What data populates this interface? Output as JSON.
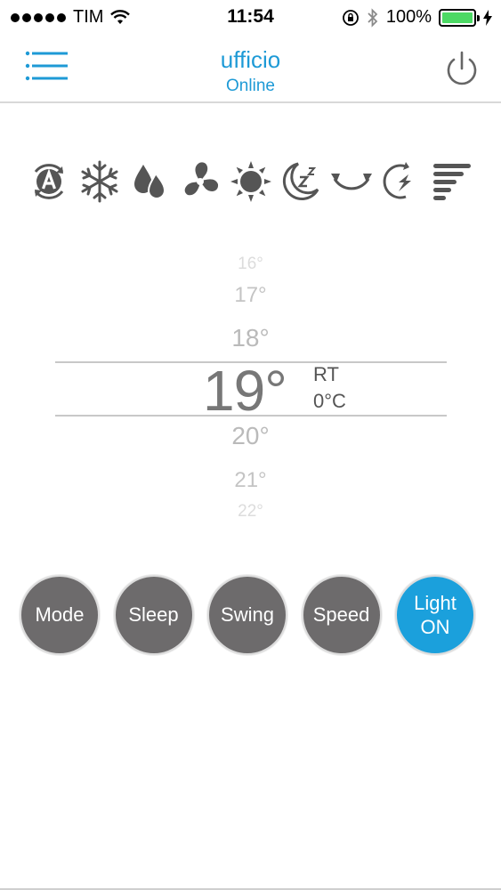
{
  "status_bar": {
    "carrier": "TIM",
    "time": "11:54",
    "battery_percent": "100%",
    "signal_dots": 5,
    "battery_level": 1.0,
    "battery_color": "#4cd964"
  },
  "header": {
    "title": "ufficio",
    "subtitle": "Online",
    "accent_color": "#1e9ad6",
    "menu_icon": "hamburger-menu-icon",
    "power_icon": "power-icon"
  },
  "mode_icons": [
    {
      "name": "auto-mode-icon",
      "letter": "A"
    },
    {
      "name": "cool-snowflake-icon"
    },
    {
      "name": "dry-droplet-icon"
    },
    {
      "name": "fan-icon"
    },
    {
      "name": "heat-sun-icon"
    },
    {
      "name": "sleep-moon-icon",
      "letter": "z"
    },
    {
      "name": "swing-icon"
    },
    {
      "name": "turbo-icon"
    },
    {
      "name": "fan-speed-bars-icon"
    }
  ],
  "temperature": {
    "above": [
      "16°",
      "17°",
      "18°"
    ],
    "current": "19°",
    "below": [
      "20°",
      "21°",
      "22°"
    ],
    "room_temp_label": "RT",
    "room_temp_value": "0°C"
  },
  "controls": {
    "mode": "Mode",
    "sleep": "Sleep",
    "swing": "Swing",
    "speed": "Speed",
    "light_line1": "Light",
    "light_line2": "ON",
    "active_color": "#1ba0dc",
    "inactive_color": "#6d6b6c"
  }
}
